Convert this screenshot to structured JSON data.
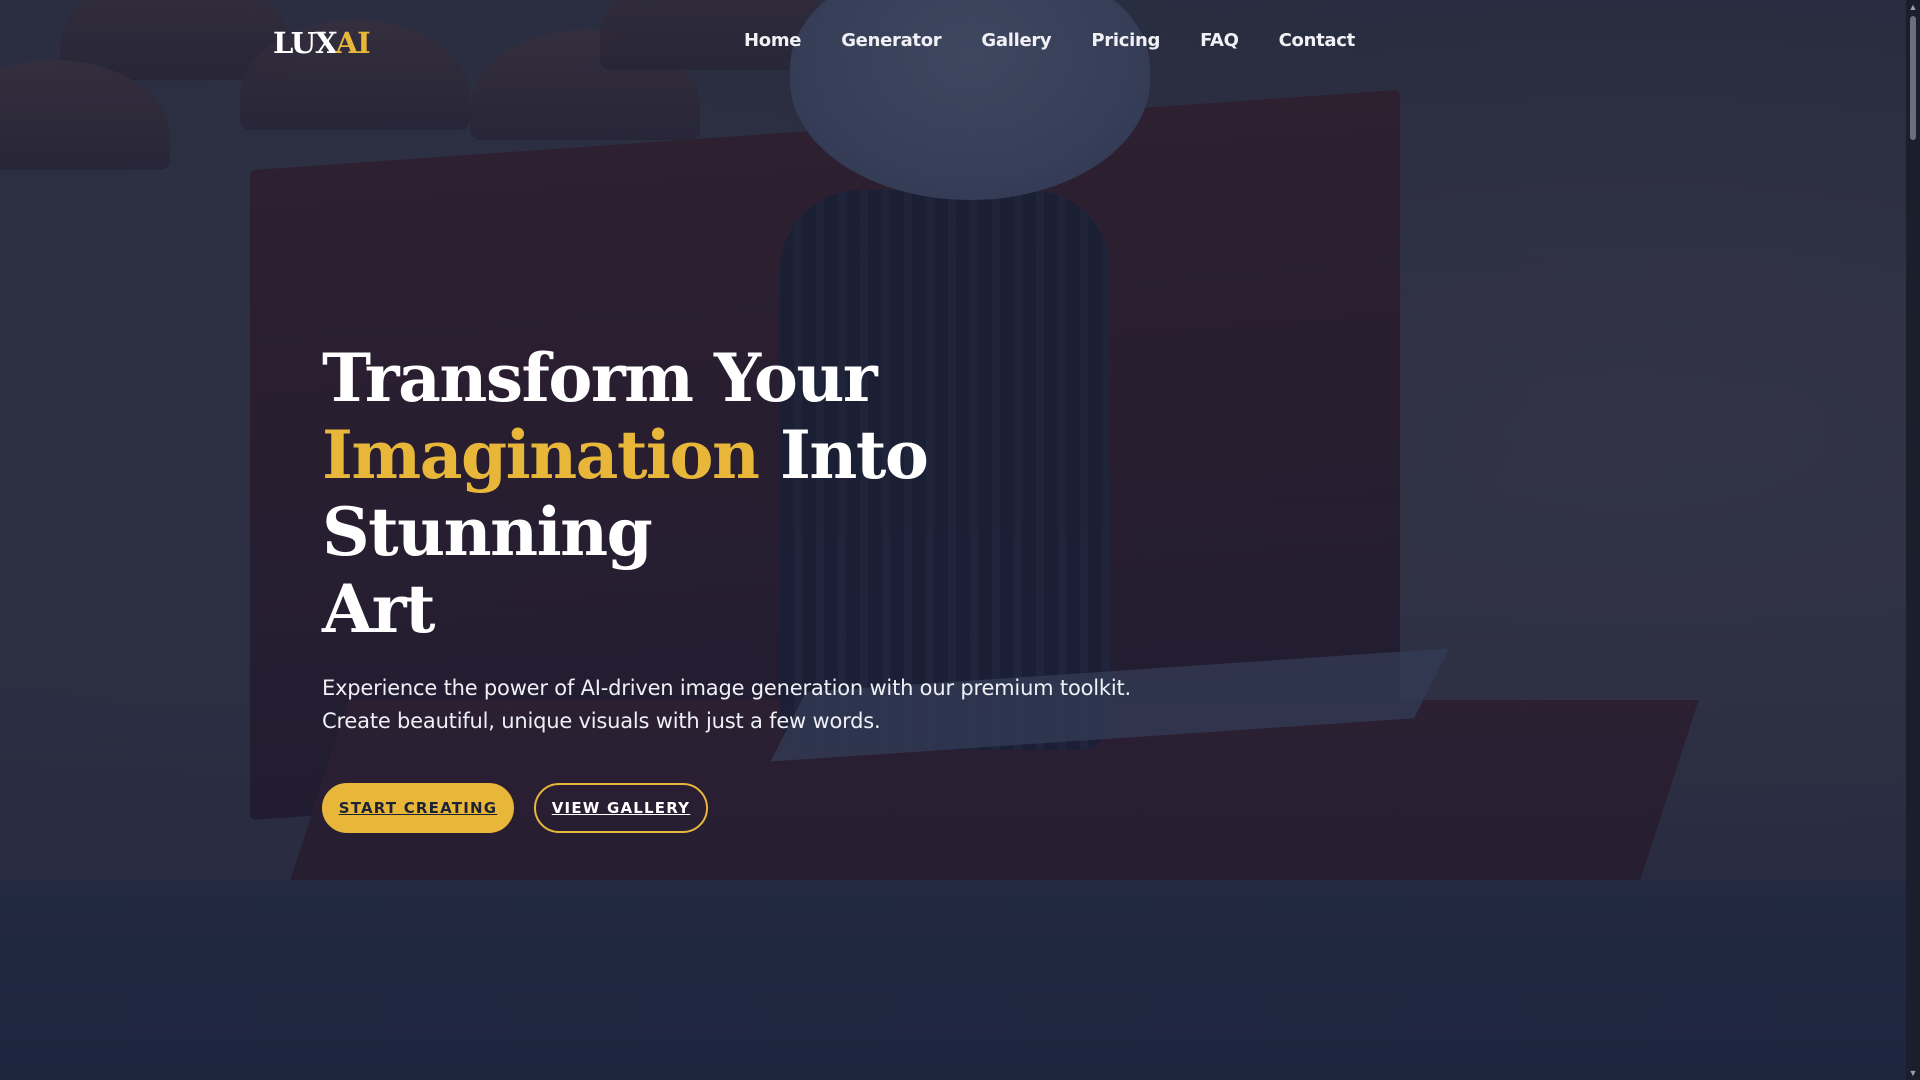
{
  "brand": {
    "logo_main": "LUX",
    "logo_accent": "AI"
  },
  "nav": {
    "items": [
      "Home",
      "Generator",
      "Gallery",
      "Pricing",
      "FAQ",
      "Contact"
    ]
  },
  "hero": {
    "title_line1": "Transform Your",
    "title_highlight": "Imagination",
    "title_line2_rest": "Into Stunning",
    "title_line3": "Art",
    "subtitle_line1": "Experience the power of AI-driven image generation with our premium toolkit.",
    "subtitle_line2": "Create beautiful, unique visuals with just a few words.",
    "primary_button": "START CREATING",
    "secondary_button": "VIEW GALLERY"
  },
  "colors": {
    "accent": "#e8b73a",
    "overlay": "#1c2240",
    "text": "#ffffff"
  },
  "icons": {
    "scroll_up": "chevron-up-icon",
    "scroll_down": "chevron-down-icon"
  }
}
